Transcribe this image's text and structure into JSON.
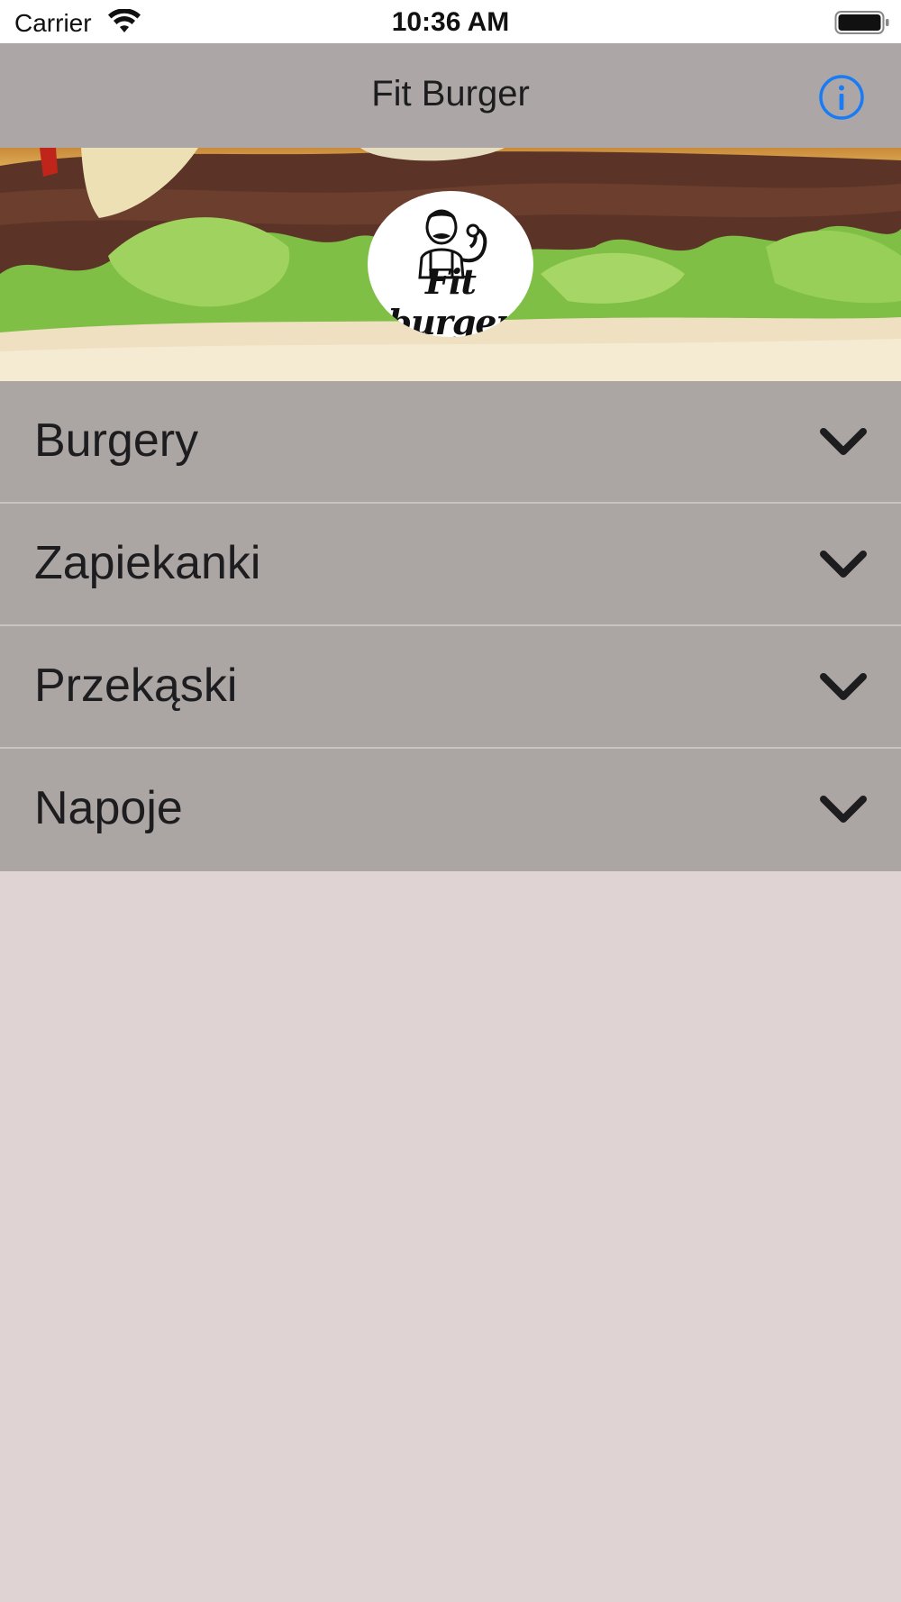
{
  "status_bar": {
    "carrier": "Carrier",
    "time": "10:36 AM",
    "wifi_icon": "wifi-icon",
    "battery_icon": "battery-full-icon"
  },
  "nav": {
    "title": "Fit Burger",
    "info_icon": "info-icon",
    "accent_color": "#1a7cf5"
  },
  "hero": {
    "logo_text": "Fit burger"
  },
  "categories": [
    {
      "label": "Burgery",
      "icon": "chevron-down-icon"
    },
    {
      "label": "Zapiekanki",
      "icon": "chevron-down-icon"
    },
    {
      "label": "Przekąski",
      "icon": "chevron-down-icon"
    },
    {
      "label": "Napoje",
      "icon": "chevron-down-icon"
    }
  ],
  "colors": {
    "nav_background": "#aca7a6",
    "row_background": "#aba5a4",
    "page_background": "#dfd4d3",
    "text": "#1d1d1f"
  }
}
